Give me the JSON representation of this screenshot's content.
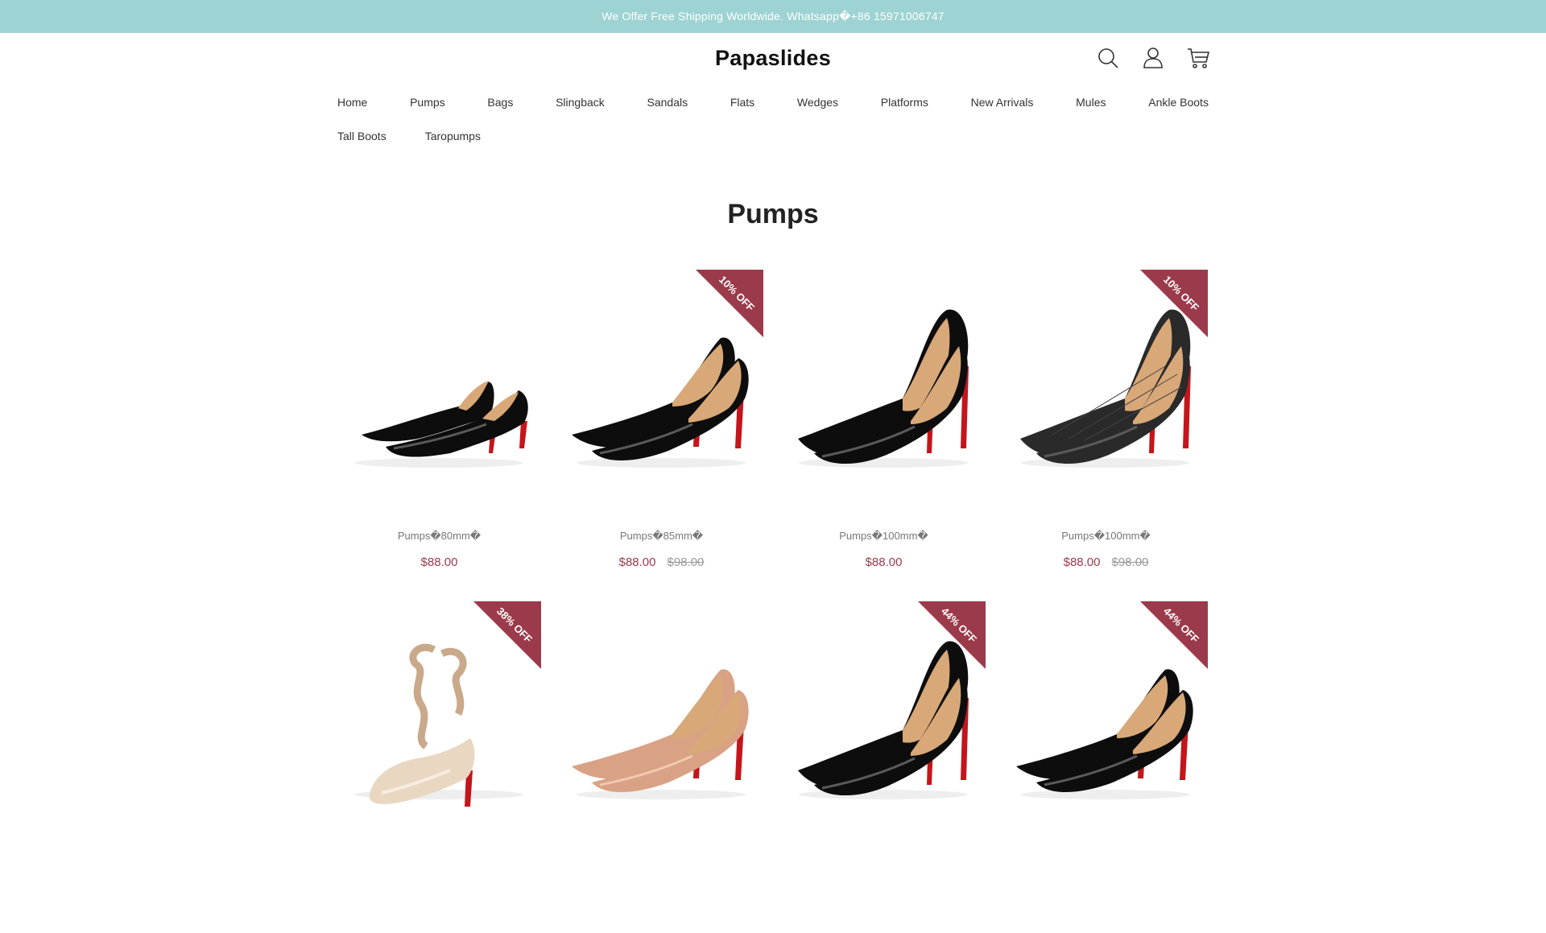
{
  "announcement": "We Offer Free Shipping Worldwide. Whatsapp�+86 15971006747",
  "brand": "Papaslides",
  "header_icons": [
    "search-icon",
    "account-icon",
    "cart-icon"
  ],
  "nav": {
    "row1": [
      "Home",
      "Pumps",
      "Bags",
      "Slingback",
      "Sandals",
      "Flats",
      "Wedges",
      "Platforms",
      "New Arrivals",
      "Mules",
      "Ankle Boots"
    ],
    "row2": [
      "Tall Boots",
      "Taropumps"
    ]
  },
  "page_title": "Pumps",
  "colors": {
    "announce_bg": "#9dd3d2",
    "badge": "#9b3a4a",
    "price": "#9b3a4a"
  },
  "products": [
    {
      "name": "Pumps�80mm�",
      "price": "$88.00",
      "old_price": "",
      "badge": "",
      "style": "slingback-black"
    },
    {
      "name": "Pumps�85mm�",
      "price": "$88.00",
      "old_price": "$98.00",
      "badge": "10% OFF",
      "style": "pump-black"
    },
    {
      "name": "Pumps�100mm�",
      "price": "$88.00",
      "old_price": "",
      "badge": "",
      "style": "wave-black"
    },
    {
      "name": "Pumps�100mm�",
      "price": "$88.00",
      "old_price": "$98.00",
      "badge": "10% OFF",
      "style": "mesh-black"
    },
    {
      "name": "",
      "price": "",
      "old_price": "",
      "badge": "38% OFF",
      "style": "ribbon-nude"
    },
    {
      "name": "",
      "price": "",
      "old_price": "",
      "badge": "",
      "style": "pump-nude"
    },
    {
      "name": "",
      "price": "",
      "old_price": "",
      "badge": "44% OFF",
      "style": "wave-black"
    },
    {
      "name": "",
      "price": "",
      "old_price": "",
      "badge": "44% OFF",
      "style": "pump-black"
    }
  ]
}
